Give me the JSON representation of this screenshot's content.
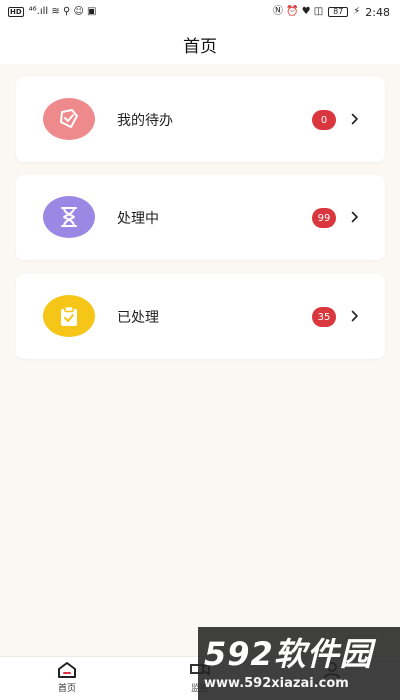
{
  "status_bar": {
    "left_badge": "HD",
    "left_glyphs": "⁴⁶.ıll ≋ ⚲ ☺ ▣",
    "right_glyphs": "Ⓝ ⏰ ♥ ◫",
    "battery": "87",
    "charging": "⚡",
    "time": "2:48"
  },
  "header": {
    "title": "首页"
  },
  "cards": [
    {
      "label": "我的待办",
      "count": "0",
      "icon": "todo-check-icon",
      "color": "#ef8a8c"
    },
    {
      "label": "处理中",
      "count": "99",
      "icon": "hourglass-icon",
      "color": "#9b87e4"
    },
    {
      "label": "已处理",
      "count": "35",
      "icon": "clipboard-check-icon",
      "color": "#f5c518"
    }
  ],
  "nav": {
    "home_label": "首页",
    "monitor_label": "监控"
  },
  "watermark": {
    "main": "592软件园",
    "sub": "www.592xiazai.com"
  }
}
